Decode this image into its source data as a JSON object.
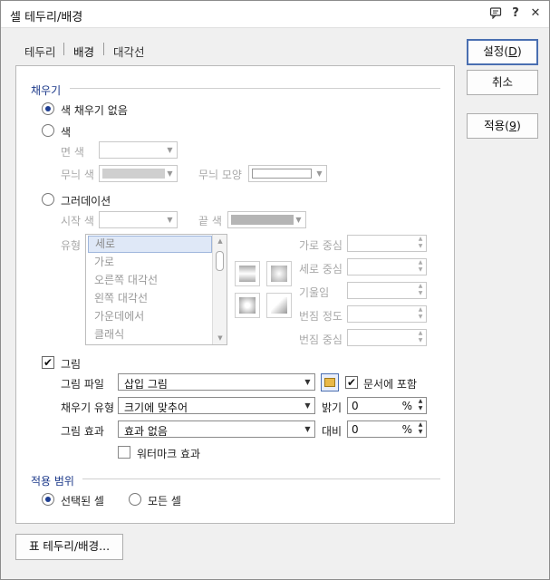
{
  "window": {
    "title": "셀 테두리/배경",
    "icons": [
      "comment-icon",
      "help-icon",
      "close-icon"
    ],
    "help_glyph": "?",
    "close_glyph": "✕"
  },
  "tabs": [
    {
      "label": "테두리",
      "active": false
    },
    {
      "label": "배경",
      "active": true
    },
    {
      "label": "대각선",
      "active": false
    }
  ],
  "buttons": {
    "ok": "설정(D)",
    "ok_parts": [
      "설정(",
      "D",
      ")"
    ],
    "cancel": "취소",
    "apply": "적용(9)",
    "apply_parts": [
      "적용(",
      "9",
      ")"
    ],
    "table_border": "표 테두리/배경..."
  },
  "fill": {
    "section_title": "채우기",
    "no_fill": {
      "label": "색 채우기 없음",
      "selected": true
    },
    "color": {
      "label": "색",
      "selected": false,
      "face_color_label": "면 색",
      "pattern_color_label": "무늬 색",
      "pattern_shape_label": "무늬 모양"
    },
    "gradient": {
      "label": "그러데이션",
      "selected": false,
      "start_color_label": "시작 색",
      "end_color_label": "끝 색",
      "type_label": "유형",
      "types": [
        "세로",
        "가로",
        "오른쪽 대각선",
        "왼쪽 대각선",
        "가운데에서",
        "클래식"
      ],
      "selected_type": "세로",
      "h_center_label": "가로 중심",
      "v_center_label": "세로 중심",
      "tilt_label": "기울임",
      "blur_label": "번짐 정도",
      "blur_center_label": "번짐 중심"
    },
    "picture": {
      "label": "그림",
      "checked": true,
      "file_label": "그림 파일",
      "file_value": "삽입 그림",
      "include_in_doc_label": "문서에 포함",
      "include_in_doc_checked": true,
      "fill_type_label": "채우기 유형",
      "fill_type_value": "크기에 맞추어",
      "brightness_label": "밝기",
      "brightness_value": "0",
      "effect_label": "그림 효과",
      "effect_value": "효과 없음",
      "contrast_label": "대비",
      "contrast_value": "0",
      "percent": "%",
      "watermark_label": "워터마크 효과",
      "watermark_checked": false
    }
  },
  "scope": {
    "section_title": "적용 범위",
    "selected_cells": {
      "label": "선택된 셀",
      "selected": true
    },
    "all_cells": {
      "label": "모든 셀",
      "selected": false
    }
  },
  "colors": {
    "accent": "#1f3f93",
    "section_title": "#1d3a8a",
    "disabled_text": "#a8a8a8",
    "default_button_border": "#4a6fb1"
  }
}
